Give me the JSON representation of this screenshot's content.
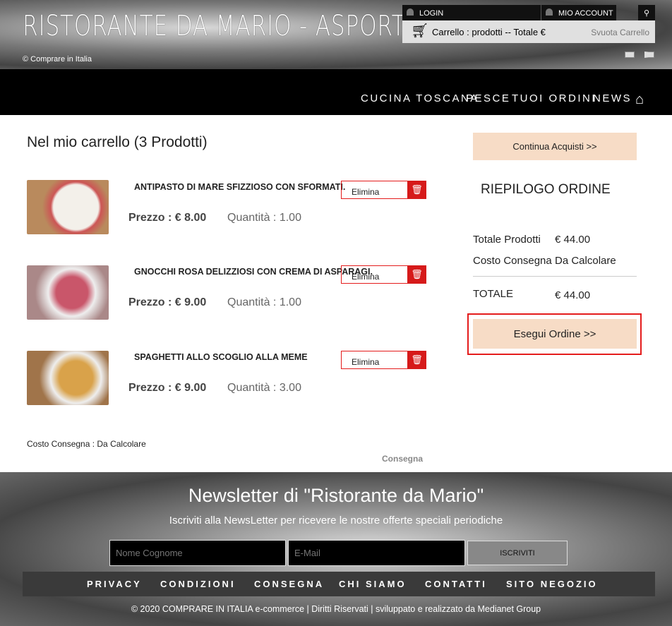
{
  "header": {
    "logo": "RISTORANTE DA MARIO - ASPORTO",
    "tagline": "© Comprare in Italia",
    "login": "LOGIN",
    "account": "MIO ACCOUNT",
    "cart_text": "Carrello : prodotti -- Totale €",
    "empty_cart": "Svuota Carrello"
  },
  "nav": [
    "CUCINA TOSCANA",
    "PESCE",
    "TUOI ORDINI",
    "NEWS"
  ],
  "cart": {
    "title": "Nel mio carrello (3 Prodotti)",
    "delete_label": "Elimina",
    "items": [
      {
        "name": "ANTIPASTO DI MARE SFIZZIOSO CON SFORMATI.",
        "price": "Prezzo : € 8.00",
        "qty": "Quantità : 1.00"
      },
      {
        "name": "GNOCCHI ROSA DELIZZIOSI CON CREMA DI ASPARAGI.",
        "price": "Prezzo : € 9.00",
        "qty": "Quantità : 1.00"
      },
      {
        "name": "SPAGHETTI ALLO SCOGLIO ALLA MEME",
        "price": "Prezzo : € 9.00",
        "qty": "Quantità : 3.00"
      }
    ],
    "delivery_cost": "Costo Consegna : Da Calcolare",
    "delivery": "Consegna"
  },
  "summary": {
    "continue": "Continua Acquisti >>",
    "title": "RIEPILOGO ORDINE",
    "products_label": "Totale Prodotti",
    "products_value": "€ 44.00",
    "delivery_label": "Costo Consegna",
    "delivery_value": "Da Calcolare",
    "total_label": "TOTALE",
    "total_value": "€ 44.00",
    "checkout": "Esegui Ordine >>"
  },
  "footer": {
    "newsletter_title": "Newsletter di \"Ristorante da Mario\"",
    "newsletter_sub": "Iscriviti alla NewsLetter per ricevere le nostre offerte speciali periodiche",
    "name_placeholder": "Nome Cognome",
    "email_placeholder": "E-Mail",
    "subscribe": "ISCRIVITI",
    "links": [
      "PRIVACY",
      "CONDIZIONI",
      "CONSEGNA",
      "CHI SIAMO",
      "CONTATTI",
      "SITO NEGOZIO"
    ],
    "copyright": "© 2020 COMPRARE IN ITALIA e-commerce | Diritti Riservati | sviluppato e realizzato da Medianet Group"
  }
}
